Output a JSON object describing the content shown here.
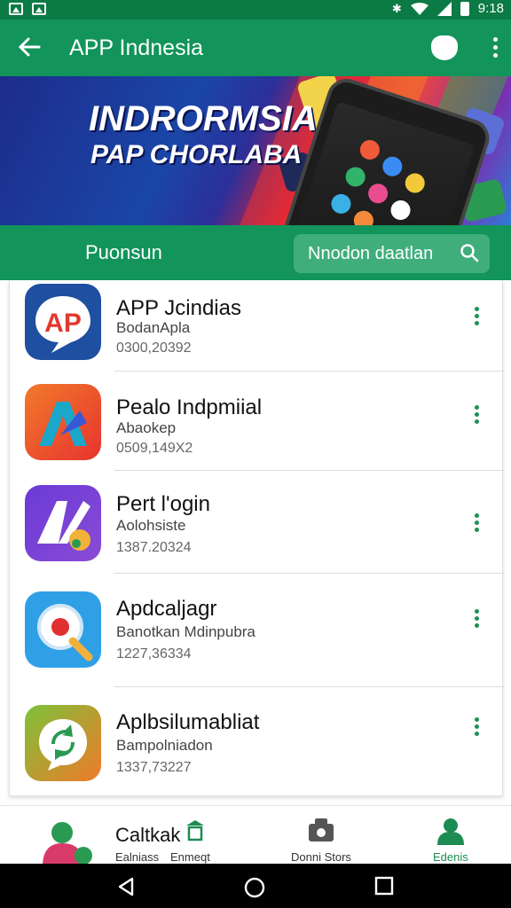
{
  "status_bar": {
    "time": "9:18"
  },
  "app_bar": {
    "title": "APP Indnesia"
  },
  "banner": {
    "headline": "INDRORMSIA",
    "subheadline": "PAP CHORLABA"
  },
  "search_row": {
    "label": "Puonsun",
    "search_placeholder": "Nnodon daatlan"
  },
  "apps": [
    {
      "name": "APP Jcindias",
      "developer": "BodanApla",
      "downloads": "0300,20392",
      "icon": "ap-speech-bubble-icon"
    },
    {
      "name": "Pealo Indpmiial",
      "developer": "Abaokep",
      "downloads": "0509,149X2",
      "icon": "arrow-a-icon"
    },
    {
      "name": "Pert l'ogin",
      "developer": "Aolohsiste",
      "downloads": "1387.20324",
      "icon": "purple-a-icon"
    },
    {
      "name": "Apdcaljagr",
      "developer": "Banotkan Mdinpubra",
      "downloads": "1227,36334",
      "icon": "magnifier-icon"
    },
    {
      "name": "Aplbsilumabliat",
      "developer": "Bampolniadon",
      "downloads": "1337,73227",
      "icon": "chat-refresh-icon"
    }
  ],
  "bottom_nav": {
    "category_title": "Caltkak",
    "category_sub1": "Ealniass",
    "category_sub2": "Enmeqt",
    "middle_label": "Donni Stors",
    "right_label": "Edenis"
  },
  "colors": {
    "primary": "#12945a",
    "status": "#0c7a45",
    "accent": "#1f8f55"
  }
}
